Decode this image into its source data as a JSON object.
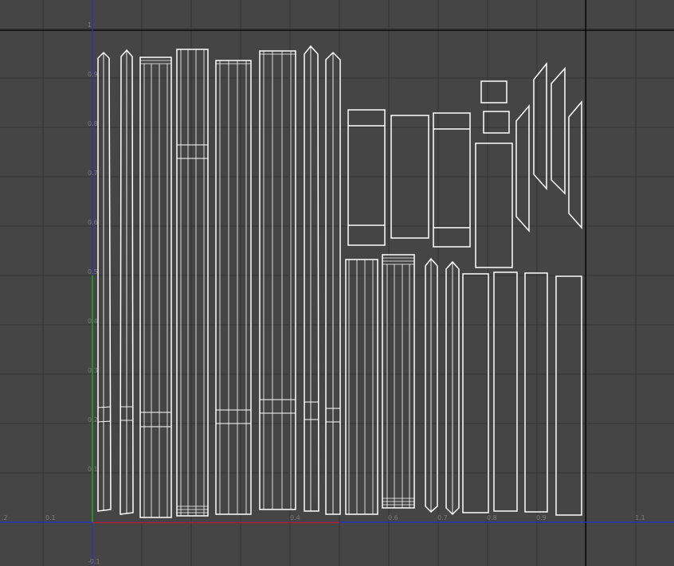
{
  "viewport": {
    "background_color": "#454545",
    "grid_color": "#333333",
    "frame_line_color": "#000000",
    "wire_color": "#ffffff",
    "u_axis_color": "#2233cc",
    "v_axis_color": "#1fa31f",
    "u_highlight_color": "#b32020"
  },
  "u_ticks": [
    {
      "id": "u-2",
      "label": ".2"
    },
    {
      "id": "u-1",
      "label": "0.1"
    },
    {
      "id": "u04",
      "label": "0.4"
    },
    {
      "id": "u06",
      "label": "0.6"
    },
    {
      "id": "u07",
      "label": "0.7"
    },
    {
      "id": "u08",
      "label": "0.8"
    },
    {
      "id": "u09",
      "label": "0.9"
    },
    {
      "id": "u11",
      "label": "1.1"
    }
  ],
  "v_ticks": [
    {
      "id": "v1",
      "label": "1"
    },
    {
      "id": "v09",
      "label": "0.9"
    },
    {
      "id": "v08",
      "label": "0.8"
    },
    {
      "id": "v07",
      "label": "0.7"
    },
    {
      "id": "v06",
      "label": "0.6"
    },
    {
      "id": "v05",
      "label": "0.5"
    },
    {
      "id": "v04",
      "label": "0.4"
    },
    {
      "id": "v03",
      "label": "0.3"
    },
    {
      "id": "v02",
      "label": "0.2"
    },
    {
      "id": "v01",
      "label": "0.1"
    },
    {
      "id": "vm1",
      "label": "-0.1"
    }
  ]
}
